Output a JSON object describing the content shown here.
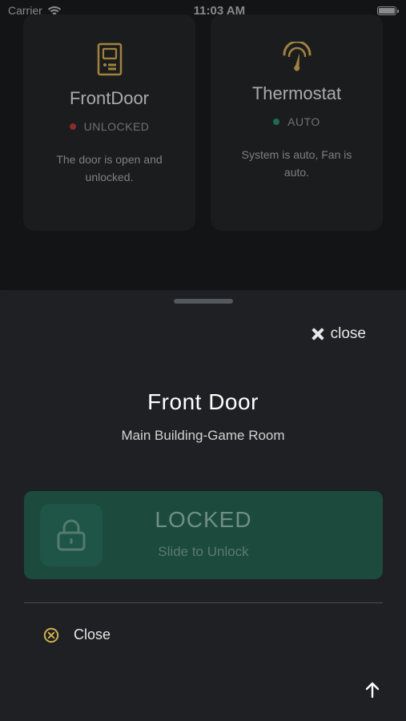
{
  "status_bar": {
    "carrier": "Carrier",
    "time": "11:03 AM"
  },
  "cards": [
    {
      "title": "FrontDoor",
      "status": "UNLOCKED",
      "status_color": "#8c2b2b",
      "description": "The door is open and unlocked.",
      "icon": "door-panel-icon"
    },
    {
      "title": "Thermostat",
      "status": "AUTO",
      "status_color": "#1e6b50",
      "description": "System is auto, Fan is auto.",
      "icon": "gauge-icon"
    }
  ],
  "sheet": {
    "close_label": "close",
    "title": "Front Door",
    "subtitle": "Main Building-Game Room",
    "slider": {
      "state": "LOCKED",
      "hint": "Slide to Unlock",
      "icon": "padlock-icon"
    },
    "footer_close_label": "Close",
    "footer_close_icon": "circle-x-icon",
    "scroll_top_icon": "arrow-up-icon"
  },
  "colors": {
    "accent_gold": "#c9a14a",
    "slider_green": "#1c4a3d"
  }
}
